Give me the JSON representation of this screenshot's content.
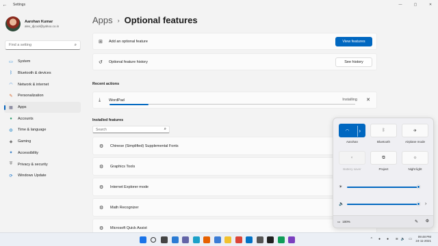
{
  "window": {
    "title": "Settings",
    "controls": [
      "minimize-icon",
      "maximize-icon",
      "close-icon"
    ]
  },
  "profile": {
    "name": "Aarohan Kumar",
    "email": "alex_djcool@yahoo.co.in"
  },
  "search": {
    "placeholder": "Find a setting"
  },
  "sidebar": {
    "items": [
      {
        "label": "System",
        "icon": "monitor-icon",
        "color": "#0078d4"
      },
      {
        "label": "Bluetooth & devices",
        "icon": "bluetooth-icon",
        "color": "#0067c0"
      },
      {
        "label": "Network & internet",
        "icon": "wifi-icon",
        "color": "#2d7dd2"
      },
      {
        "label": "Personalization",
        "icon": "brush-icon",
        "color": "#d45f1f"
      },
      {
        "label": "Apps",
        "icon": "apps-icon",
        "color": "#5a5a7a",
        "active": true
      },
      {
        "label": "Accounts",
        "icon": "person-icon",
        "color": "#2a9d6a"
      },
      {
        "label": "Time & language",
        "icon": "globe-clock-icon",
        "color": "#1f86c9"
      },
      {
        "label": "Gaming",
        "icon": "gamepad-icon",
        "color": "#7a7a7a"
      },
      {
        "label": "Accessibility",
        "icon": "accessibility-icon",
        "color": "#1f6fbf"
      },
      {
        "label": "Privacy & security",
        "icon": "shield-icon",
        "color": "#666666"
      },
      {
        "label": "Windows Update",
        "icon": "update-icon",
        "color": "#1a73c8"
      }
    ]
  },
  "breadcrumb": {
    "parent": "Apps",
    "separator": "›",
    "current": "Optional features"
  },
  "add_feature": {
    "label": "Add an optional feature",
    "button": "View features"
  },
  "history": {
    "label": "Optional feature history",
    "button": "See history"
  },
  "recent_actions": {
    "title": "Recent actions",
    "item": {
      "name": "WordPad",
      "status": "Installing",
      "progress": 0.16
    }
  },
  "installed": {
    "title": "Installed features",
    "search_placeholder": "Search",
    "items": [
      "Chinese (Simplified) Supplemental Fonts",
      "Graphics Tools",
      "Internet Explorer mode",
      "Math Recognizer",
      "Microsoft Quick Assist"
    ]
  },
  "quick_settings": {
    "tiles": [
      {
        "label": "Aarohan",
        "icon": "wifi-icon",
        "state": "on"
      },
      {
        "label": "Bluetooth",
        "icon": "bluetooth-icon",
        "state": "off"
      },
      {
        "label": "Airplane mode",
        "icon": "airplane-icon",
        "state": "off"
      },
      {
        "label": "Battery saver",
        "icon": "battery-saver-icon",
        "state": "disabled"
      },
      {
        "label": "Project",
        "icon": "project-icon",
        "state": "off"
      },
      {
        "label": "Night light",
        "icon": "night-light-icon",
        "state": "off"
      }
    ],
    "brightness": 1.0,
    "volume": 1.0,
    "battery": "100%"
  },
  "taskbar": {
    "icons": [
      {
        "name": "start-icon",
        "color": "#1a73e8"
      },
      {
        "name": "search-icon",
        "color": "#333333"
      },
      {
        "name": "task-view-icon",
        "color": "#444444"
      },
      {
        "name": "widgets-icon",
        "color": "#2a7bd4"
      },
      {
        "name": "chat-icon",
        "color": "#6264a7"
      },
      {
        "name": "edge-icon",
        "color": "#1aa0c8"
      },
      {
        "name": "firefox-icon",
        "color": "#e66000"
      },
      {
        "name": "store-icon",
        "color": "#3a7bd5"
      },
      {
        "name": "explorer-icon",
        "color": "#f2c12e"
      },
      {
        "name": "chrome-icon",
        "color": "#db4437"
      },
      {
        "name": "mail-icon",
        "color": "#0072c6"
      },
      {
        "name": "settings-icon",
        "color": "#555555"
      },
      {
        "name": "media-icon",
        "color": "#1f1f1f"
      },
      {
        "name": "app-icon",
        "color": "#0f9d58"
      },
      {
        "name": "app2-icon",
        "color": "#7b3fbf"
      }
    ],
    "time": "09:48 PM",
    "date": "24-11-2021"
  }
}
